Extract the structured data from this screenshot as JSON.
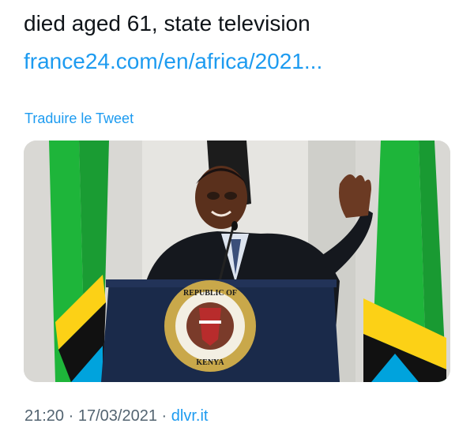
{
  "tweet": {
    "text_line_top": "died aged 61, state television",
    "text_line_bottom": "",
    "partial_top": "",
    "link_text": "france24.com/en/africa/2021...",
    "translate_label": "Traduire le Tweet"
  },
  "media": {
    "seal_top_text": "REPUBLIC OF",
    "seal_bottom_text": "KENYA"
  },
  "meta": {
    "time": "21:20",
    "separator": "·",
    "date": "17/03/2021",
    "source": "dlvr.it"
  },
  "colors": {
    "link": "#1d9bf0",
    "text": "#0f1419",
    "secondary": "#536471",
    "flag_green": "#1eb53a",
    "flag_yellow": "#fcd116",
    "flag_black": "#000000",
    "flag_blue": "#00a3dd"
  }
}
